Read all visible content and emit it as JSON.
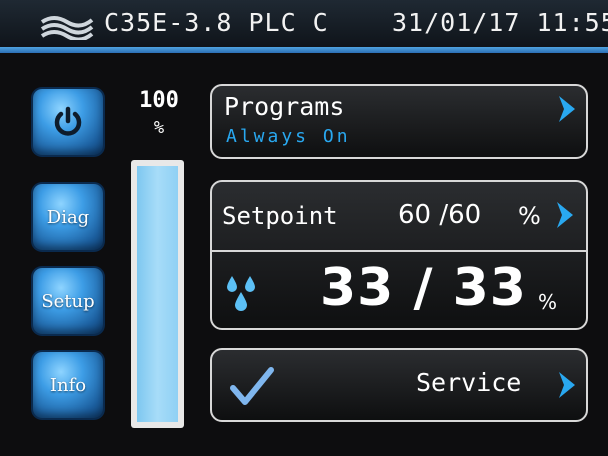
{
  "header": {
    "logo_icon": "waves-logo-icon",
    "model": "C35E-3.8 PLC C",
    "datetime": "31/01/17 11:55"
  },
  "sidebar": {
    "items": [
      {
        "label": "",
        "icon": "power-icon"
      },
      {
        "label": "Diag"
      },
      {
        "label": "Setup"
      },
      {
        "label": "Info"
      }
    ]
  },
  "level": {
    "value": "100",
    "unit": "%",
    "fill_fraction": 1.0,
    "color": "#8fd0f4"
  },
  "programs": {
    "title": "Programs",
    "subtitle": "Always On",
    "icon": "chevron-right-icon"
  },
  "setpoint": {
    "label": "Setpoint",
    "value": "60 /60",
    "unit": "%",
    "icon": "chevron-right-icon",
    "current_icon": "water-drops-icon",
    "current_value": "33 / 33",
    "current_unit": "%"
  },
  "service": {
    "label": "Service",
    "status_icon": "checkmark-icon",
    "icon": "chevron-right-icon"
  },
  "colors": {
    "accent": "#29a8f0",
    "button_blue": "#3d9de6",
    "stripe": "#4fa3e0"
  }
}
